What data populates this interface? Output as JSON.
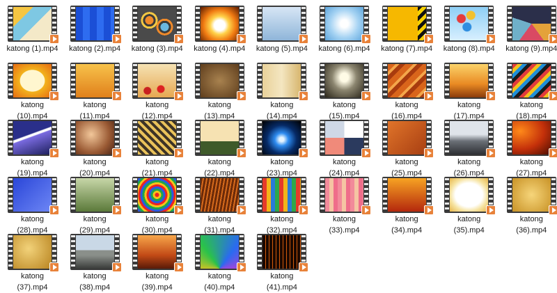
{
  "files": [
    {
      "name": "katong (1).mp4",
      "bg": "linear-gradient(135deg,#f6c642 0 28%,#7ec8e3 28% 55%,#f4e9c8 55%)"
    },
    {
      "name": "katong (2).mp4",
      "bg": "repeating-linear-gradient(90deg,#1b4fd6 0 10px,#2e6cf0 10px 20px),#1b4fd6"
    },
    {
      "name": "katong (3).mp4",
      "bg": "radial-gradient(circle at 30% 40%,#f08a2a 0 6px,#3b3b3b 6px 9px,#f3c843 9px 12px,transparent 12px),radial-gradient(circle at 70% 60%,#6ab7e0 0 6px,#3b3b3b 6px 9px,#f08a2a 9px 12px,transparent 12px),#4a4a4a"
    },
    {
      "name": "katong (4).mp4",
      "bg": "radial-gradient(ellipse at 50% 55%,#ffffff 0 20%,#ffd24a 35%,#f07a12 60%,#5a1a00 100%)"
    },
    {
      "name": "katong (5).mp4",
      "bg": "linear-gradient(180deg,#d7e6f5,#8fb5d9)"
    },
    {
      "name": "katong (6).mp4",
      "bg": "radial-gradient(circle at 50% 50%,#ffffff 0 15%,#a6d3f3 55%,#5ea6dc 100%)"
    },
    {
      "name": "katong (7).mp4",
      "bg": "linear-gradient(90deg,#f6b800 0 78%,transparent 78%),repeating-linear-gradient(135deg,#111 0 5px,#f6d000 5px 10px)"
    },
    {
      "name": "katong (8).mp4",
      "bg": "radial-gradient(circle at 30% 35%,#e53c3c 0 6px,transparent 7px),radial-gradient(circle at 55% 25%,#f2c12e 0 6px,transparent 7px),radial-gradient(circle at 45% 60%,#2f8ee0 0 6px,transparent 7px),linear-gradient(180deg,#8ecff5,#d8efff)"
    },
    {
      "name": "katong (9).mp4",
      "bg": "conic-gradient(#2b2f4a 0 25%,#e4a23a 25% 40%,#d94a63 40% 60%,#6fb0c9 60% 80%,#2b2f4a 80%)"
    },
    {
      "name": "katong\n(10).mp4",
      "bg": "radial-gradient(ellipse at 50% 50%,#fff6cf 0 45%,#f2b31d 47%,#e66b12 100%)"
    },
    {
      "name": "katong\n(11).mp4",
      "bg": "linear-gradient(180deg,#f7c24a,#e0801b)"
    },
    {
      "name": "katong\n(12).mp4",
      "bg": "radial-gradient(circle at 25% 80%,#c82020 0 5px,transparent 6px),radial-gradient(circle at 60% 75%,#d22 0 5px,transparent 6px),linear-gradient(180deg,#f5e2b3,#e6a852)"
    },
    {
      "name": "katong\n(13).mp4",
      "bg": "radial-gradient(ellipse at 50% 50%,#a8824f,#5e3d1c)"
    },
    {
      "name": "katong\n(14).mp4",
      "bg": "linear-gradient(90deg,#e9d29a,#f4e6c1,#d7b66e)"
    },
    {
      "name": "katong\n(15).mp4",
      "bg": "radial-gradient(ellipse at 50% 40%,#fffbe6 0 15%,#8c8670 45%,#2a2519 100%)"
    },
    {
      "name": "katong\n(16).mp4",
      "bg": "repeating-linear-gradient(135deg,#d9651b 0 8px,#f4a64a 8px 12px,#a83b0e 12px 18px)"
    },
    {
      "name": "katong\n(17).mp4",
      "bg": "linear-gradient(180deg,#fbd36a,#e98a23 60%,#8b3c0c)"
    },
    {
      "name": "katong\n(18).mp4",
      "bg": "repeating-linear-gradient(135deg,#e23b3b 0 5px,#f2c21c 5px 10px,#1f8fd8 10px 15px,#1b1b1b 15px 20px)"
    },
    {
      "name": "katong\n(19).mp4",
      "bg": "linear-gradient(160deg,#2a2f8a 0 40%,#ffffff 42% 46%,#7a6be0 48%,#1d1f5c)"
    },
    {
      "name": "katong\n(20).mp4",
      "bg": "radial-gradient(circle at 40% 40%,#f2c79a,#9a5a34 60%,#4a2414)"
    },
    {
      "name": "katong\n(21).mp4",
      "bg": "repeating-linear-gradient(45deg,#e9c25a 0 4px,#3d3326 4px 8px)"
    },
    {
      "name": "katong\n(22).mp4",
      "bg": "linear-gradient(180deg,#f6e2b2 0 60%,#3f5a2a 60%)"
    },
    {
      "name": "katong\n(23).mp4",
      "bg": "radial-gradient(ellipse at 50% 55%,#e6f5ff 0 8%,#2e8cf0 25%,#062a66 55%,#000000 100%)"
    },
    {
      "name": "katong\n(24).mp4",
      "bg": "conic-gradient(#ffffff 0 25%,#2b3a5e 25% 50%,#f08a7a 50% 75%,#cfd8e6 75%)"
    },
    {
      "name": "katong\n(25).mp4",
      "bg": "linear-gradient(135deg,#e0742a,#a83f12)"
    },
    {
      "name": "katong\n(26).mp4",
      "bg": "linear-gradient(180deg,#dfe4ea 0 40%,#6a6f76 60%,#2e3034)"
    },
    {
      "name": "katong\n(27).mp4",
      "bg": "radial-gradient(ellipse at 20% 30%,#ff8a1a,#c4300a 55%,#4a0e02)"
    },
    {
      "name": "katong\n(28).mp4",
      "bg": "linear-gradient(135deg,#2a46d8,#6d86f5)"
    },
    {
      "name": "katong\n(29).mp4",
      "bg": "linear-gradient(180deg,#c7d6a8,#5b7a3a)"
    },
    {
      "name": "katong\n(30).mp4",
      "bg": "repeating-radial-gradient(circle,#e22 0 3px,#f5c21a 3px 6px,#1fa64a 6px 9px,#2a5ae0 9px 12px)"
    },
    {
      "name": "katong\n(31).mp4",
      "bg": "repeating-linear-gradient(100deg,#6b2a08 0 3px,#d66a1c 3px 5px)"
    },
    {
      "name": "katong\n(32).mp4",
      "bg": "repeating-linear-gradient(90deg,#e63a2a 0 6px,#f2b51a 6px 12px,#2a7ad8 12px 18px,#2ea84a 18px 24px)"
    },
    {
      "name": "katong\n(33).mp4",
      "bg": "repeating-linear-gradient(90deg,#f28a9a 0 6px,#f5c4a3 6px 12px,#ef6d8a 12px 18px)"
    },
    {
      "name": "katong\n(34).mp4",
      "bg": "linear-gradient(180deg,#f7a323,#b4280d)"
    },
    {
      "name": "katong\n(35).mp4",
      "bg": "radial-gradient(ellipse at 50% 50%,#ffffff 0 50%,#f6e3a0 70%,#e7b64a)"
    },
    {
      "name": "katong\n(36).mp4",
      "bg": "radial-gradient(circle at 50% 50%,#f6d57a,#c89226)"
    },
    {
      "name": "katong\n(37).mp4",
      "bg": "radial-gradient(circle at 40% 40%,#f2d27a,#b8831f)"
    },
    {
      "name": "katong\n(38).mp4",
      "bg": "linear-gradient(180deg,#c9d8e6 0 45%,#8a8f8a 45% 60%,#3a3c3a)"
    },
    {
      "name": "katong\n(39).mp4",
      "bg": "linear-gradient(180deg,#f7a64a,#c24a16 60%,#5a1a08)"
    },
    {
      "name": "katong\n(40).mp4",
      "bg": "conic-gradient(from 180deg at 50% 100%,#e23,#f7c21a,#2ac24a,#2a6af0,#c23ad8,#e23)"
    },
    {
      "name": "katong\n(41).mp4",
      "bg": "repeating-linear-gradient(90deg,#1a0800 0 4px,#d25a0c 4px 5px)"
    }
  ]
}
